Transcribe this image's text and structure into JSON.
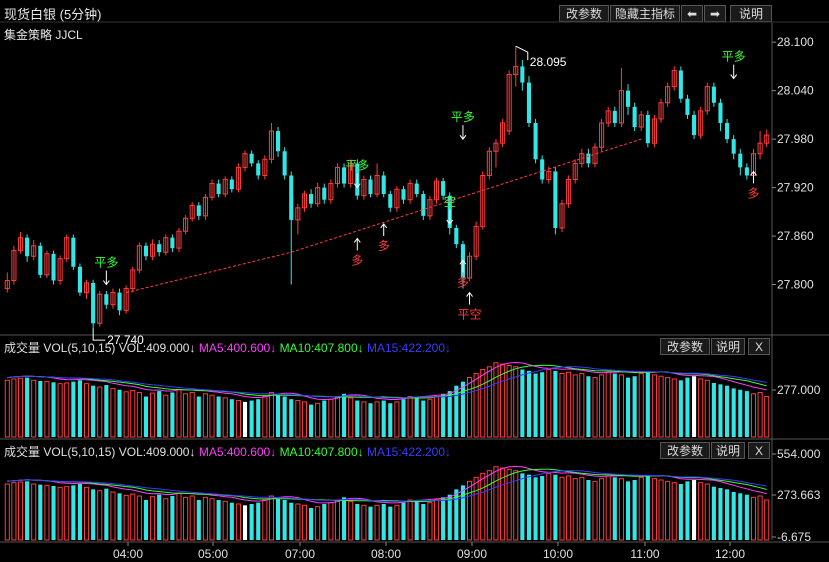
{
  "header": {
    "title": "现货白银 (5分钟)",
    "strategy": "集金策略 JJCL",
    "buttons": {
      "params": "改参数",
      "hide": "隐藏主指标",
      "left": "⬅",
      "right": "➡",
      "help": "说明"
    }
  },
  "colors": {
    "up": "#ff3b3b",
    "down": "#33e6e6",
    "signal_green": "#33ff33",
    "signal_red": "#ff3b3b",
    "ma5": "#ff3cff",
    "ma10": "#33ff33",
    "ma15": "#3a3aff",
    "trend": "#ff3b3b"
  },
  "chart_data": [
    {
      "type": "candlestick",
      "ylim": [
        27.74,
        28.125
      ],
      "yticks": [
        "28.100",
        "28.040",
        "27.980",
        "27.920",
        "27.860",
        "27.800"
      ],
      "xticks": [
        "04:00",
        "05:00",
        "07:00",
        "08:00",
        "09:00",
        "10:00",
        "11:00",
        "12:00"
      ],
      "annotations": {
        "high": "28.095",
        "low": "27.740"
      },
      "signals": [
        {
          "text": "平多",
          "kind": "green"
        },
        {
          "text": "多",
          "kind": "red"
        },
        {
          "text": "平多",
          "kind": "green"
        },
        {
          "text": "多",
          "kind": "red"
        },
        {
          "text": "平多",
          "kind": "green"
        },
        {
          "text": "空",
          "kind": "green"
        },
        {
          "text": "多",
          "kind": "red"
        },
        {
          "text": "平空",
          "kind": "red"
        },
        {
          "text": "平多",
          "kind": "green"
        },
        {
          "text": "多",
          "kind": "red"
        }
      ],
      "candles": [
        [
          27.795,
          27.805,
          27.79,
          27.815
        ],
        [
          27.805,
          27.842,
          27.8,
          27.848
        ],
        [
          27.842,
          27.858,
          27.838,
          27.865
        ],
        [
          27.858,
          27.835,
          27.828,
          27.862
        ],
        [
          27.835,
          27.848,
          27.83,
          27.855
        ],
        [
          27.848,
          27.812,
          27.808,
          27.852
        ],
        [
          27.812,
          27.838,
          27.808,
          27.842
        ],
        [
          27.838,
          27.805,
          27.8,
          27.842
        ],
        [
          27.805,
          27.832,
          27.8,
          27.836
        ],
        [
          27.832,
          27.858,
          27.828,
          27.862
        ],
        [
          27.858,
          27.822,
          27.818,
          27.862
        ],
        [
          27.822,
          27.79,
          27.786,
          27.826
        ],
        [
          27.79,
          27.802,
          27.782,
          27.806
        ],
        [
          27.802,
          27.752,
          27.746,
          27.806
        ],
        [
          27.752,
          27.788,
          27.748,
          27.792
        ],
        [
          27.788,
          27.775,
          27.77,
          27.792
        ],
        [
          27.775,
          27.79,
          27.77,
          27.795
        ],
        [
          27.79,
          27.768,
          27.762,
          27.795
        ],
        [
          27.768,
          27.795,
          27.764,
          27.799
        ],
        [
          27.795,
          27.818,
          27.79,
          27.822
        ],
        [
          27.818,
          27.848,
          27.814,
          27.852
        ],
        [
          27.848,
          27.835,
          27.83,
          27.852
        ],
        [
          27.835,
          27.85,
          27.83,
          27.856
        ],
        [
          27.85,
          27.84,
          27.835,
          27.855
        ],
        [
          27.84,
          27.858,
          27.836,
          27.862
        ],
        [
          27.858,
          27.845,
          27.84,
          27.862
        ],
        [
          27.845,
          27.866,
          27.84,
          27.87
        ],
        [
          27.866,
          27.882,
          27.862,
          27.886
        ],
        [
          27.882,
          27.898,
          27.878,
          27.902
        ],
        [
          27.898,
          27.885,
          27.88,
          27.902
        ],
        [
          27.885,
          27.908,
          27.88,
          27.912
        ],
        [
          27.908,
          27.925,
          27.904,
          27.93
        ],
        [
          27.925,
          27.912,
          27.908,
          27.93
        ],
        [
          27.912,
          27.93,
          27.908,
          27.934
        ],
        [
          27.93,
          27.918,
          27.914,
          27.934
        ],
        [
          27.918,
          27.945,
          27.914,
          27.95
        ],
        [
          27.945,
          27.962,
          27.94,
          27.966
        ],
        [
          27.962,
          27.95,
          27.946,
          27.966
        ],
        [
          27.95,
          27.935,
          27.93,
          27.954
        ],
        [
          27.935,
          27.955,
          27.93,
          27.96
        ],
        [
          27.955,
          27.99,
          27.95,
          28.0
        ],
        [
          27.99,
          27.965,
          27.958,
          27.995
        ],
        [
          27.965,
          27.935,
          27.93,
          27.97
        ],
        [
          27.935,
          27.88,
          27.8,
          27.94
        ],
        [
          27.88,
          27.895,
          27.862,
          27.9
        ],
        [
          27.895,
          27.912,
          27.89,
          27.916
        ],
        [
          27.912,
          27.9,
          27.895,
          27.918
        ],
        [
          27.9,
          27.92,
          27.896,
          27.926
        ],
        [
          27.92,
          27.905,
          27.9,
          27.925
        ],
        [
          27.905,
          27.925,
          27.9,
          27.93
        ],
        [
          27.925,
          27.945,
          27.92,
          27.95
        ],
        [
          27.945,
          27.925,
          27.92,
          27.95
        ],
        [
          27.925,
          27.95,
          27.92,
          27.955
        ],
        [
          27.95,
          27.91,
          27.905,
          27.955
        ],
        [
          27.91,
          27.93,
          27.905,
          27.935
        ],
        [
          27.93,
          27.912,
          27.908,
          27.935
        ],
        [
          27.912,
          27.935,
          27.908,
          27.95
        ],
        [
          27.935,
          27.912,
          27.908,
          27.94
        ],
        [
          27.912,
          27.895,
          27.89,
          27.916
        ],
        [
          27.895,
          27.918,
          27.89,
          27.922
        ],
        [
          27.918,
          27.905,
          27.9,
          27.922
        ],
        [
          27.905,
          27.925,
          27.9,
          27.93
        ],
        [
          27.925,
          27.912,
          27.908,
          27.93
        ],
        [
          27.912,
          27.885,
          27.88,
          27.916
        ],
        [
          27.885,
          27.905,
          27.88,
          27.91
        ],
        [
          27.905,
          27.928,
          27.9,
          27.932
        ],
        [
          27.928,
          27.91,
          27.905,
          27.932
        ],
        [
          27.91,
          27.87,
          27.862,
          27.914
        ],
        [
          27.87,
          27.85,
          27.845,
          27.874
        ],
        [
          27.85,
          27.808,
          27.795,
          27.854
        ],
        [
          27.808,
          27.835,
          27.804,
          27.84
        ],
        [
          27.835,
          27.872,
          27.83,
          27.878
        ],
        [
          27.872,
          27.935,
          27.868,
          27.94
        ],
        [
          27.935,
          27.965,
          27.93,
          27.97
        ],
        [
          27.965,
          27.975,
          27.945,
          27.98
        ],
        [
          27.975,
          28.0,
          27.97,
          28.005
        ],
        [
          27.99,
          28.06,
          27.985,
          28.065
        ],
        [
          28.06,
          28.07,
          28.045,
          28.095
        ],
        [
          28.07,
          28.05,
          28.04,
          28.078
        ],
        [
          28.05,
          28.0,
          27.995,
          28.058
        ],
        [
          28.0,
          27.955,
          27.95,
          28.005
        ],
        [
          27.955,
          27.93,
          27.925,
          27.96
        ],
        [
          27.93,
          27.94,
          27.925,
          27.946
        ],
        [
          27.94,
          27.87,
          27.862,
          27.945
        ],
        [
          27.87,
          27.9,
          27.865,
          27.905
        ],
        [
          27.9,
          27.93,
          27.895,
          27.935
        ],
        [
          27.93,
          27.95,
          27.925,
          27.955
        ],
        [
          27.95,
          27.962,
          27.945,
          27.968
        ],
        [
          27.962,
          27.95,
          27.945,
          27.968
        ],
        [
          27.95,
          27.97,
          27.945,
          27.975
        ],
        [
          27.97,
          28.0,
          27.965,
          28.005
        ],
        [
          28.0,
          28.015,
          27.995,
          28.02
        ],
        [
          28.015,
          28.0,
          27.995,
          28.02
        ],
        [
          28.0,
          28.04,
          27.995,
          28.068
        ],
        [
          28.04,
          28.02,
          28.01,
          28.048
        ],
        [
          28.02,
          27.995,
          27.99,
          28.025
        ],
        [
          27.995,
          28.01,
          27.99,
          28.015
        ],
        [
          28.01,
          27.975,
          27.97,
          28.015
        ],
        [
          27.975,
          28.005,
          27.97,
          28.01
        ],
        [
          28.005,
          28.025,
          28.0,
          28.03
        ],
        [
          28.025,
          28.045,
          28.02,
          28.05
        ],
        [
          28.045,
          28.065,
          28.04,
          28.07
        ],
        [
          28.065,
          28.03,
          28.025,
          28.07
        ],
        [
          28.03,
          28.01,
          28.005,
          28.035
        ],
        [
          28.01,
          27.985,
          27.98,
          28.015
        ],
        [
          27.985,
          28.015,
          27.98,
          28.02
        ],
        [
          28.015,
          28.045,
          28.01,
          28.05
        ],
        [
          28.045,
          28.025,
          28.02,
          28.05
        ],
        [
          28.025,
          28.0,
          27.99,
          28.03
        ],
        [
          28.0,
          27.98,
          27.975,
          28.005
        ],
        [
          27.98,
          27.962,
          27.955,
          27.985
        ],
        [
          27.962,
          27.945,
          27.935,
          27.968
        ],
        [
          27.945,
          27.935,
          27.93,
          27.95
        ],
        [
          27.935,
          27.962,
          27.93,
          27.968
        ],
        [
          27.962,
          27.975,
          27.955,
          27.99
        ],
        [
          27.975,
          27.985,
          27.97,
          27.992
        ]
      ]
    },
    {
      "type": "bar",
      "label": "成交量",
      "indicator": "VOL(5,10,15)",
      "vol_text": "VOL:409.000↓",
      "ma5_text": "MA5:400.600↓",
      "ma10_text": "MA10:407.800↓",
      "ma15_text": "MA15:422.200↓",
      "ytick": "277.000"
    },
    {
      "type": "bar",
      "label": "成交量",
      "indicator": "VOL(5,10,15)",
      "vol_text": "VOL:409.000↓",
      "ma5_text": "MA5:400.600↓",
      "ma10_text": "MA10:407.800↓",
      "ma15_text": "MA15:422.200↓",
      "yticks": [
        "554.000",
        "273.663",
        "-6.675"
      ],
      "ylim": [
        -6.675,
        554.0
      ]
    }
  ],
  "volume": [
    420,
    430,
    435,
    440,
    420,
    415,
    410,
    405,
    395,
    400,
    410,
    420,
    395,
    380,
    370,
    385,
    360,
    350,
    335,
    345,
    330,
    300,
    325,
    340,
    310,
    330,
    350,
    320,
    330,
    300,
    320,
    310,
    300,
    290,
    280,
    270,
    260,
    270,
    280,
    300,
    330,
    310,
    300,
    280,
    270,
    260,
    240,
    250,
    270,
    280,
    300,
    320,
    290,
    270,
    260,
    250,
    260,
    270,
    250,
    260,
    280,
    300,
    290,
    270,
    280,
    300,
    320,
    340,
    380,
    410,
    440,
    470,
    500,
    520,
    550,
    540,
    530,
    520,
    500,
    490,
    470,
    480,
    500,
    490,
    470,
    480,
    460,
    470,
    450,
    440,
    460,
    480,
    470,
    460,
    440,
    450,
    470,
    480,
    460,
    450,
    440,
    430,
    420,
    440,
    450,
    430,
    420,
    400,
    390,
    380,
    360,
    350,
    340,
    320,
    330,
    300
  ],
  "white_bars": [
    36,
    104
  ],
  "panel_buttons": {
    "params": "改参数",
    "help": "说明",
    "close": "X"
  }
}
